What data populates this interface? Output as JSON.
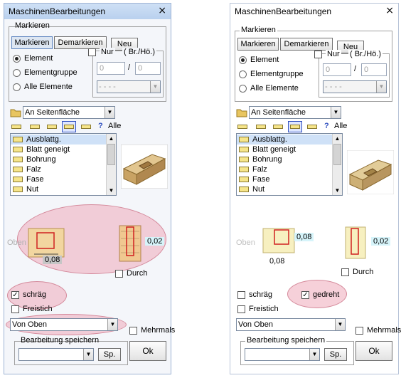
{
  "left": {
    "title": "MaschinenBearbeitungen",
    "close": "×",
    "markieren": {
      "legend": "Markieren",
      "tab_markieren": "Markieren",
      "tab_demarkieren": "Demarkieren",
      "neu": "Neu"
    },
    "nur": {
      "label": "Nur",
      "dims": "( Br./Hö.)",
      "from": "0",
      "to": "0",
      "sep": "/"
    },
    "radios": [
      "Element",
      "Elementgruppe",
      "Alle Elemente"
    ],
    "range_combo": "- - - -",
    "face_combo": "An Seitenfläche",
    "toolbar_alle": "Alle",
    "toolbar_q": "?",
    "list": [
      "Ausblattg.",
      "Blatt geneigt",
      "Bohrung",
      "Falz",
      "Fase",
      "Nut"
    ],
    "oben": "Oben",
    "dim_a": "0,08",
    "dim_b": "0,02",
    "durch": "Durch",
    "schraeg": "schräg",
    "freistich": "Freistich",
    "von_oben": "Von Oben",
    "mehrmals": "Mehrmals",
    "speichern_legend": "Bearbeitung speichern",
    "sp": "Sp.",
    "ok": "Ok"
  },
  "right": {
    "title": "MaschinenBearbeitungen",
    "close": "×",
    "markieren": {
      "legend": "Markieren",
      "tab_markieren": "Markieren",
      "tab_demarkieren": "Demarkieren",
      "neu": "Neu"
    },
    "nur": {
      "label": "Nur",
      "dims": "( Br./Hö.)",
      "from": "0",
      "to": "0",
      "sep": "/"
    },
    "radios": [
      "Element",
      "Elementgruppe",
      "Alle Elemente"
    ],
    "range_combo": "- - - -",
    "face_combo": "An Seitenfläche",
    "toolbar_alle": "Alle",
    "toolbar_q": "?",
    "list": [
      "Ausblattg.",
      "Blatt geneigt",
      "Bohrung",
      "Falz",
      "Fase",
      "Nut"
    ],
    "oben": "Oben",
    "dim_a": "0,08",
    "dim_a2": "0,08",
    "dim_b": "0,02",
    "durch": "Durch",
    "schraeg": "schräg",
    "gedreht": "gedreht",
    "freistich": "Freistich",
    "von_oben": "Von Oben",
    "mehrmals": "Mehrmals",
    "speichern_legend": "Bearbeitung speichern",
    "sp": "Sp.",
    "ok": "Ok"
  },
  "colors": {
    "highlight": "#eeaab9",
    "wood": "#d8b878",
    "accent": "#3050c0"
  }
}
